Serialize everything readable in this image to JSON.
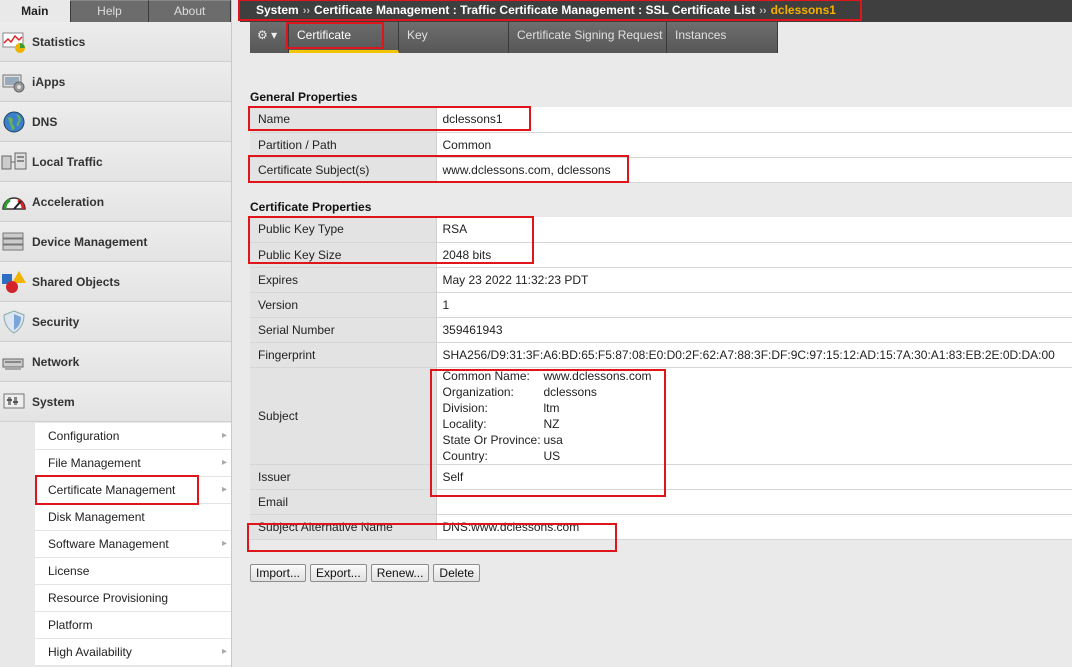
{
  "sidebar": {
    "tabs": [
      {
        "label": "Main",
        "active": true
      },
      {
        "label": "Help",
        "active": false
      },
      {
        "label": "About",
        "active": false
      }
    ],
    "nav": [
      {
        "label": "Statistics",
        "icon": "statistics-icon"
      },
      {
        "label": "iApps",
        "icon": "iapps-icon"
      },
      {
        "label": "DNS",
        "icon": "dns-globe-icon"
      },
      {
        "label": "Local Traffic",
        "icon": "local-traffic-icon"
      },
      {
        "label": "Acceleration",
        "icon": "gauge-icon"
      },
      {
        "label": "Device Management",
        "icon": "server-icon"
      },
      {
        "label": "Shared Objects",
        "icon": "shapes-icon"
      },
      {
        "label": "Security",
        "icon": "shield-icon"
      },
      {
        "label": "Network",
        "icon": "network-icon"
      },
      {
        "label": "System",
        "icon": "system-icon"
      }
    ],
    "submenu": [
      {
        "label": "Configuration",
        "arrow": true
      },
      {
        "label": "File Management",
        "arrow": true
      },
      {
        "label": "Certificate Management",
        "arrow": true
      },
      {
        "label": "Disk Management",
        "arrow": false
      },
      {
        "label": "Software Management",
        "arrow": true
      },
      {
        "label": "License",
        "arrow": false
      },
      {
        "label": "Resource Provisioning",
        "arrow": false
      },
      {
        "label": "Platform",
        "arrow": false
      },
      {
        "label": "High Availability",
        "arrow": true
      }
    ]
  },
  "header": {
    "breadcrumb": [
      "System",
      "Certificate Management : Traffic Certificate Management : SSL Certificate List",
      "dclessons1"
    ],
    "sep": "››",
    "tabs": {
      "gear": "⚙ ▾",
      "certificate": "Certificate",
      "key": "Key",
      "csr": "Certificate Signing Request",
      "instances": "Instances"
    }
  },
  "general": {
    "title": "General Properties",
    "rows": [
      {
        "key": "Name",
        "value": "dclessons1"
      },
      {
        "key": "Partition / Path",
        "value": "Common"
      },
      {
        "key": "Certificate Subject(s)",
        "value": "www.dclessons.com, dclessons"
      }
    ]
  },
  "certificate": {
    "title": "Certificate Properties",
    "public_key_type": {
      "key": "Public Key Type",
      "value": "RSA"
    },
    "public_key_size": {
      "key": "Public Key Size",
      "value": "2048 bits"
    },
    "expires": {
      "key": "Expires",
      "value": "May 23 2022 11:32:23 PDT"
    },
    "version": {
      "key": "Version",
      "value": "1"
    },
    "serial": {
      "key": "Serial Number",
      "value": "359461943"
    },
    "fingerprint": {
      "key": "Fingerprint",
      "value": "SHA256/D9:31:3F:A6:BD:65:F5:87:08:E0:D0:2F:62:A7:88:3F:DF:9C:97:15:12:AD:15:7A:30:A1:83:EB:2E:0D:DA:00"
    },
    "subject": {
      "key": "Subject",
      "fields": [
        {
          "label": "Common Name:",
          "value": "www.dclessons.com"
        },
        {
          "label": "Organization:",
          "value": "dclessons"
        },
        {
          "label": "Division:",
          "value": "ltm"
        },
        {
          "label": "Locality:",
          "value": "NZ"
        },
        {
          "label": "State Or Province:",
          "value": "usa"
        },
        {
          "label": "Country:",
          "value": "US"
        }
      ]
    },
    "issuer": {
      "key": "Issuer",
      "value": "Self"
    },
    "email": {
      "key": "Email",
      "value": ""
    },
    "san": {
      "key": "Subject Alternative Name",
      "value": "DNS:www.dclessons.com"
    }
  },
  "buttons": {
    "import": "Import...",
    "export": "Export...",
    "renew": "Renew...",
    "delete": "Delete"
  },
  "colors": {
    "highlight": "#e0141b",
    "active_breadcrumb": "#f5b000",
    "active_tab_underline": "#f5c400"
  }
}
